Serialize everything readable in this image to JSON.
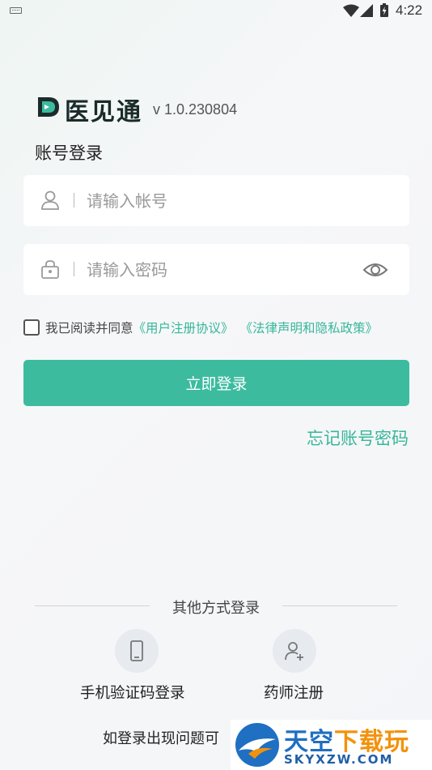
{
  "status_bar": {
    "time": "4:22"
  },
  "header": {
    "app_name": "医见通",
    "version": "v 1.0.230804",
    "page_title": "账号登录"
  },
  "form": {
    "account_placeholder": "请输入帐号",
    "password_placeholder": "请输入密码",
    "agree_prefix": "我已阅读并同意",
    "user_agreement_link": "《用户注册协议》",
    "privacy_policy_link": "《法律声明和隐私政策》",
    "login_button": "立即登录",
    "forgot_link": "忘记账号密码"
  },
  "other_login": {
    "title": "其他方式登录",
    "sms_login_label": "手机验证码登录",
    "register_label": "药师注册"
  },
  "help_text": "如登录出现问题可",
  "watermark": {
    "title_part1": "天空",
    "title_part2": "下载玩",
    "url": "SKYXZW.COM"
  },
  "colors": {
    "accent": "#3cbb9f",
    "link": "#36b79a",
    "background": "#f4f5f8"
  },
  "icons": {
    "account_field": "user-icon",
    "password_field": "lock-icon",
    "password_toggle": "eye-icon",
    "sms_login": "phone-icon",
    "register": "add-user-icon"
  }
}
